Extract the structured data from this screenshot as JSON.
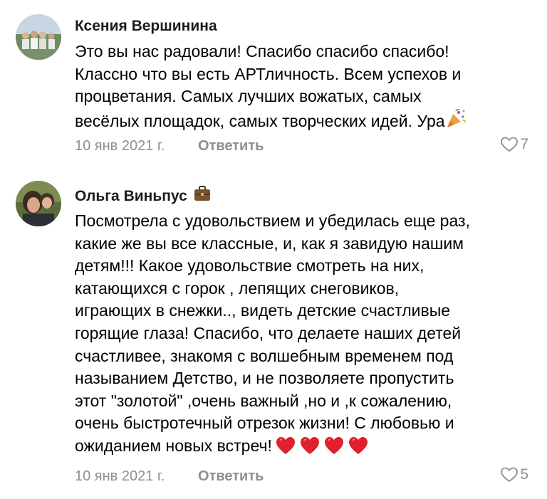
{
  "comments": [
    {
      "author": "Ксения Вершинина",
      "text": "Это вы нас радовали! Спасибо спасибо спасибо!\nКлассно что вы есть АРТличность. Всем успехов и\nпроцветания. Самых лучших вожатых, самых\nвесёлых площадок, самых творческих идей. Ура",
      "trailing_emoji": "party-popper-icon",
      "date": "10 янв 2021 г.",
      "reply_label": "Ответить",
      "likes": "7"
    },
    {
      "author": "Ольга Виньпус",
      "author_badge": "briefcase-icon",
      "text": "Посмотрела с удовольствием и убедилась еще раз,\nкакие же вы все классные, и, как я завидую нашим\nдетям!!! Какое удовольствие смотреть на них,\nкатающихся с горок , лепящих снеговиков,\nиграющих в снежки.., видеть детские счастливые\nгорящие глаза! Спасибо, что делаете наших детей\nсчастливее, знакомя с волшебным временем под\nназыванием Детство, и не позволяете пропустить\nэтот \"золотой\" ,очень важный ,но и ,к сожалению,\nочень быстротечный отрезок жизни! С любовью и\nожиданием новых встреч!",
      "trailing_emoji": "red-heart-icon x4",
      "date": "10 янв 2021 г.",
      "reply_label": "Ответить",
      "likes": "5"
    }
  ],
  "colors": {
    "meta_gray": "#8e8e93",
    "heart_red": "#e0202e"
  }
}
